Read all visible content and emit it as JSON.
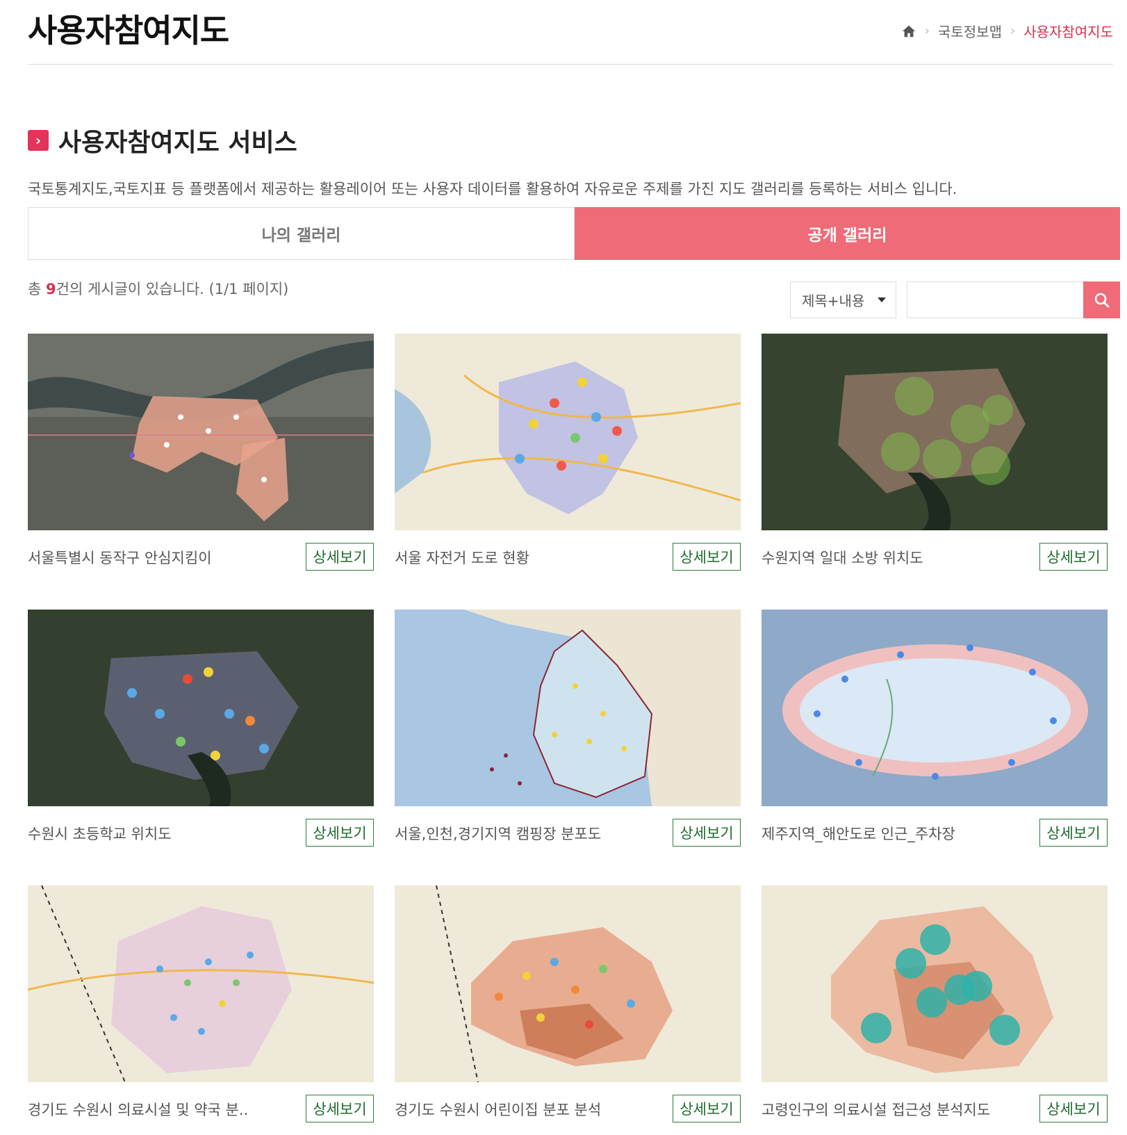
{
  "page": {
    "title": "사용자참여지도"
  },
  "breadcrumb": {
    "home_icon": "home-icon",
    "items": [
      "국토정보맵",
      "사용자참여지도"
    ]
  },
  "section": {
    "title": "사용자참여지도 서비스",
    "mark_icon": "chevron-right-icon",
    "description": "국토통계지도,국토지표 등 플랫폼에서 제공하는 활용레이어 또는 사용자 데이터를 활용하여 자유로운 주제를 가진 지도 갤러리를 등록하는 서비스 입니다."
  },
  "tabs": [
    {
      "label": "나의 갤러리",
      "active": false
    },
    {
      "label": "공개 갤러리",
      "active": true
    }
  ],
  "count": {
    "prefix": "총 ",
    "number": "9",
    "suffix": "건의 게시글이 있습니다. (1/1 페이지)"
  },
  "search": {
    "select_value": "제목+내용",
    "input_value": "",
    "button_icon": "search-icon"
  },
  "colors": {
    "accent": "#f06b78",
    "accent_dark": "#d9304c",
    "detail_border": "#2e7d3c"
  },
  "gallery": [
    {
      "title": "서울특별시 동작구 안심지킴이",
      "button": "상세보기"
    },
    {
      "title": "서울 자전거 도로 현황",
      "button": "상세보기"
    },
    {
      "title": "수원지역 일대 소방 위치도",
      "button": "상세보기"
    },
    {
      "title": "수원시 초등학교 위치도",
      "button": "상세보기"
    },
    {
      "title": "서울,인천,경기지역 캠핑장 분포도",
      "button": "상세보기"
    },
    {
      "title": "제주지역_해안도로 인근_주차장",
      "button": "상세보기"
    },
    {
      "title": "경기도 수원시 의료시설 및 약국 분..",
      "button": "상세보기"
    },
    {
      "title": "경기도 수원시 어린이집 분포 분석",
      "button": "상세보기"
    },
    {
      "title": "고령인구의 의료시설 접근성 분석지도",
      "button": "상세보기"
    }
  ]
}
